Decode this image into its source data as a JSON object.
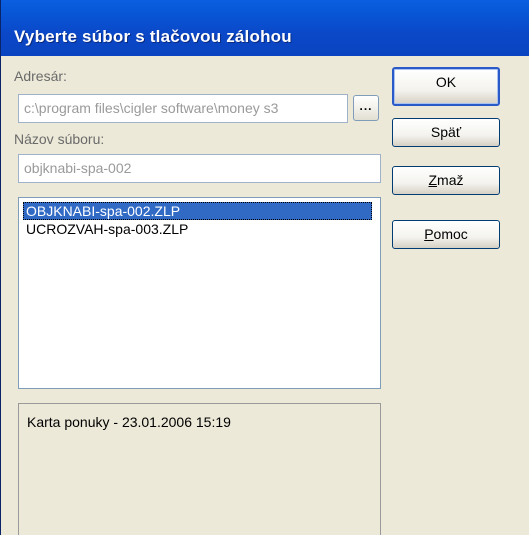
{
  "dialog": {
    "title": "Vyberte súbor s tlačovou zálohou"
  },
  "directory": {
    "label": "Adresár:",
    "value": "c:\\program files\\cigler software\\money s3",
    "browse_label": "..."
  },
  "filename": {
    "label": "Názov súboru:",
    "value": "objknabi-spa-002"
  },
  "files": {
    "items": [
      {
        "label": "OBJKNABI-spa-002.ZLP",
        "selected": true
      },
      {
        "label": "UCROZVAH-spa-003.ZLP",
        "selected": false
      }
    ]
  },
  "info": {
    "text": "Karta ponuky - 23.01.2006 15:19"
  },
  "buttons": {
    "ok": "OK",
    "back": "Späť",
    "delete_accel": "Z",
    "delete_rest": "maž",
    "help_accel": "P",
    "help_rest": "omoc"
  },
  "colors": {
    "titlebar": "#0a4fd0",
    "selection": "#316ac5",
    "dialog_bg": "#ece9d8"
  }
}
